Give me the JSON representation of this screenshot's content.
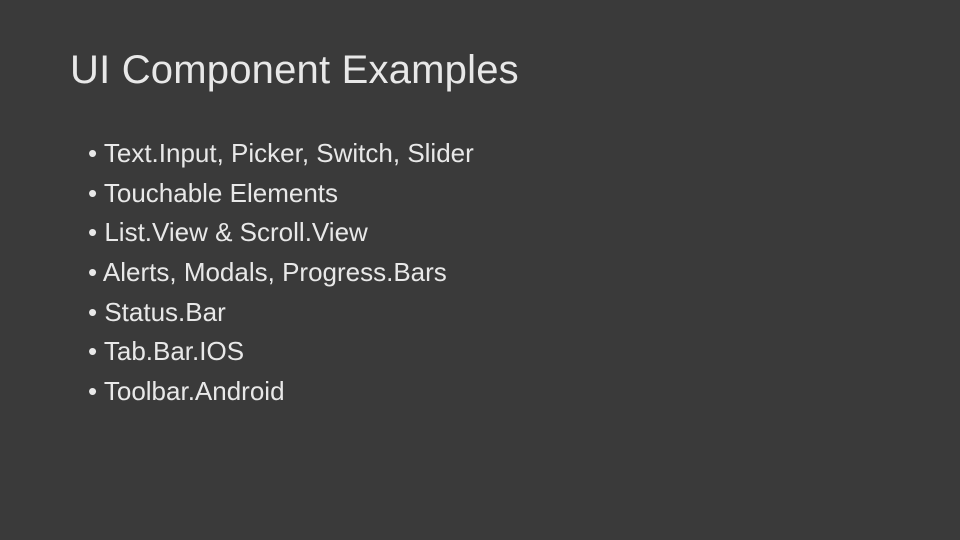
{
  "slide": {
    "title": "UI Component Examples",
    "bullets": [
      "Text.Input, Picker, Switch, Slider",
      "Touchable Elements",
      "List.View & Scroll.View",
      "Alerts, Modals, Progress.Bars",
      "Status.Bar",
      "Tab.Bar.IOS",
      "Toolbar.Android"
    ]
  }
}
